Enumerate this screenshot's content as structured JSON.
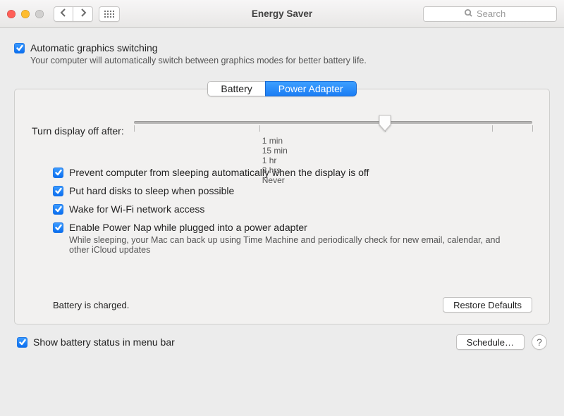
{
  "window": {
    "title": "Energy Saver",
    "search_placeholder": "Search"
  },
  "auto_gfx": {
    "label": "Automatic graphics switching",
    "description": "Your computer will automatically switch between graphics modes for better battery life."
  },
  "tabs": {
    "battery": "Battery",
    "power_adapter": "Power Adapter"
  },
  "slider": {
    "label": "Turn display off after:",
    "marks": {
      "m1": "1 min",
      "m15": "15 min",
      "h1": "1 hr",
      "h3": "3 hrs",
      "never": "Never"
    },
    "value_percent": 63
  },
  "options": {
    "prevent_sleep": "Prevent computer from sleeping automatically when the display is off",
    "hard_disks": "Put hard disks to sleep when possible",
    "wake_wifi": "Wake for Wi-Fi network access",
    "power_nap": "Enable Power Nap while plugged into a power adapter",
    "power_nap_desc": "While sleeping, your Mac can back up using Time Machine and periodically check for new email, calendar, and other iCloud updates"
  },
  "status": "Battery is charged.",
  "buttons": {
    "restore": "Restore Defaults",
    "schedule": "Schedule…",
    "help": "?"
  },
  "menubar_opt": "Show battery status in menu bar"
}
